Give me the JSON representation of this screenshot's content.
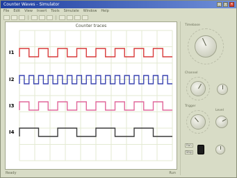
{
  "window": {
    "title": "Counter Waves - Simulator"
  },
  "menubar": [
    "File",
    "Edit",
    "View",
    "Insert",
    "Tools",
    "Simulate",
    "Window",
    "Help"
  ],
  "scope": {
    "title": "Counter traces",
    "channels": [
      {
        "label": "I1",
        "color": "#d83a3a",
        "periods": 8
      },
      {
        "label": "I2",
        "color": "#3a44b0",
        "periods": 16
      },
      {
        "label": "I3",
        "color": "#e0669a",
        "periods": 8
      },
      {
        "label": "I4",
        "color": "#3a3a3a",
        "periods": 4
      }
    ]
  },
  "status": {
    "left": "Ready",
    "right": "Run"
  },
  "panel": {
    "timebase_label": "Timebase",
    "channel_label": "Channel",
    "trigger_label": "Trigger",
    "level_label": "Level",
    "run_label": "Run",
    "stop_label": "Stop"
  },
  "colors": {
    "accent": "#1f3fa0",
    "grid": "#e3ead2"
  }
}
